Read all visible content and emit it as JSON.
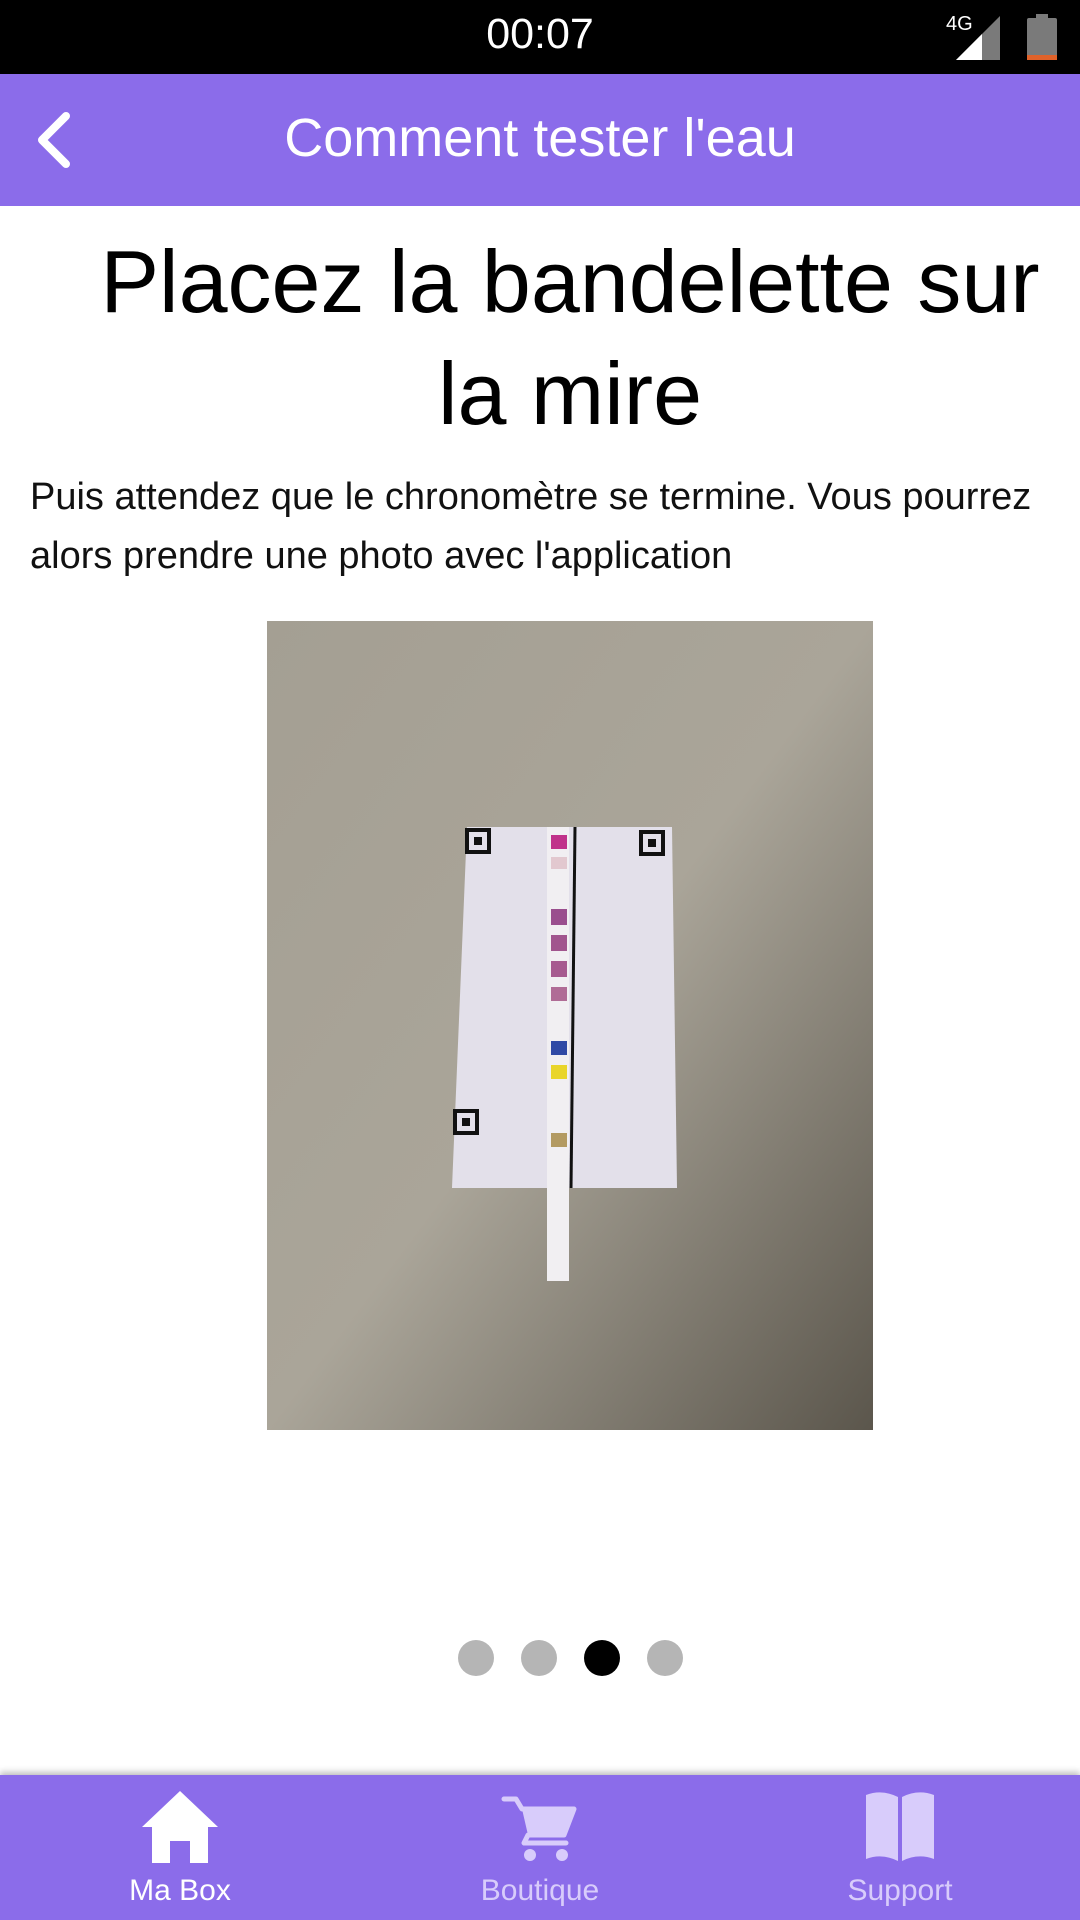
{
  "status_bar": {
    "time": "00:07",
    "network": "4G",
    "signal_icon": "cellular-signal-icon",
    "battery_icon": "battery-low-icon"
  },
  "app_bar": {
    "title": "Comment tester l'eau",
    "back_icon": "chevron-left-icon"
  },
  "content": {
    "heading": "Placez la bandelette sur la mire",
    "description": "Puis attendez que le chronomètre se termine. Vous pourrez alors prendre une photo avec l'application"
  },
  "pager": {
    "total": 4,
    "active_index": 2
  },
  "bottom_nav": {
    "items": [
      {
        "label": "Ma Box",
        "icon": "home-icon",
        "active": true
      },
      {
        "label": "Boutique",
        "icon": "cart-icon",
        "active": false
      },
      {
        "label": "Support",
        "icon": "book-icon",
        "active": false
      }
    ]
  },
  "colors": {
    "accent": "#8b6cea",
    "status_bar": "#000000",
    "dot_active": "#000000",
    "dot_inactive": "#b5b5b5",
    "battery_low": "#e0622a"
  }
}
